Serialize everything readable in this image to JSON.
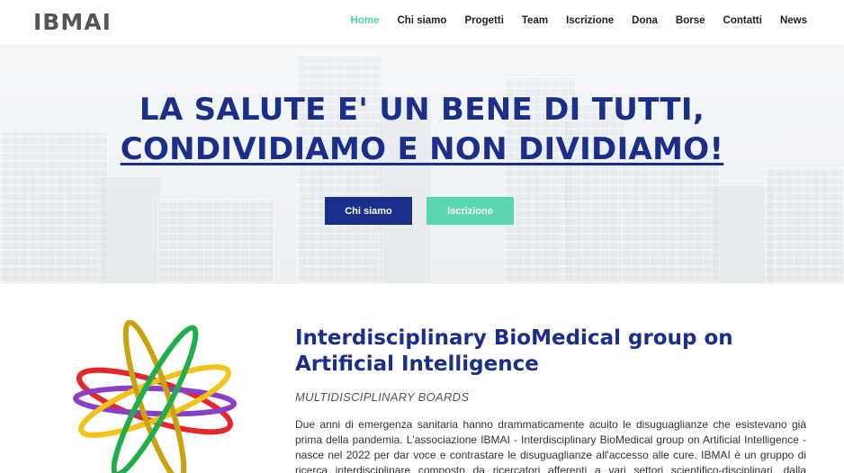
{
  "header": {
    "logo": "IBMAI",
    "nav": [
      {
        "label": "Home",
        "active": true
      },
      {
        "label": "Chi siamo"
      },
      {
        "label": "Progetti"
      },
      {
        "label": "Team"
      },
      {
        "label": "Iscrizione"
      },
      {
        "label": "Dona"
      },
      {
        "label": "Borse"
      },
      {
        "label": "Contatti"
      },
      {
        "label": "News"
      }
    ]
  },
  "hero": {
    "title_line1": "LA SALUTE E' UN BENE DI TUTTI,",
    "title_line2": "CONDIVIDIAMO E NON DIVIDIAMO!",
    "primary_button": "Chi siamo",
    "secondary_button": "Iscrizione"
  },
  "about": {
    "heading": "Interdisciplinary BioMedical group on Artificial Intelligence",
    "subheading": "MULTIDISCIPLINARY BOARDS",
    "paragraph": "Due anni di emergenza sanitaria hanno drammaticamente acuito le disuguaglianze che esistevano già prima della pandemia. L'associazione IBMAI - Interdisciplinary BioMedical group on Artificial Intelligence - nasce nel 2022 per dar voce e contrastare le disuguaglianze all'accesso alle cure. IBMAI è un gruppo di ricerca interdisciplinare composto da ricercatori afferenti a vari settori scientifico-disciplinari, dalla medicina, alla biologia, alla chimica,"
  },
  "colors": {
    "brand_blue": "#1a2e8a",
    "accent_green": "#4fd1a5",
    "emblem": [
      "#e6262b",
      "#8a3fc4",
      "#f2c21a",
      "#c9a20f",
      "#1fae4b"
    ]
  }
}
